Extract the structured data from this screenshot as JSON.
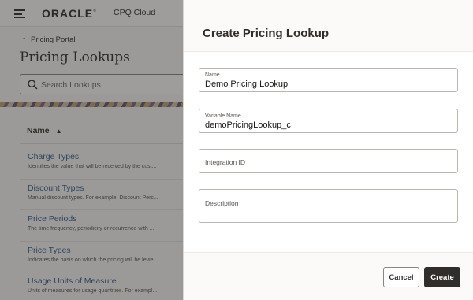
{
  "header": {
    "brand": "ORACLE",
    "brand_mark": "®",
    "app_name": "CPQ Cloud"
  },
  "breadcrumb": {
    "label": "Pricing Portal"
  },
  "page": {
    "title": "Pricing Lookups"
  },
  "search": {
    "placeholder": "Search Lookups"
  },
  "table": {
    "column_header": "Name",
    "items": [
      {
        "name": "Charge Types",
        "description": "Identifies the value that will be received by the cust..."
      },
      {
        "name": "Discount Types",
        "description": "Manual discount types. For example, Discount Perc..."
      },
      {
        "name": "Price Periods",
        "description": "The time frequency, periodicity or recurrence with ..."
      },
      {
        "name": "Price Types",
        "description": "Indicates the basis on which the pricing will be levie..."
      },
      {
        "name": "Usage Units of Measure",
        "description": "Units of measures for usage quantities. For exampl..."
      }
    ]
  },
  "drawer": {
    "title": "Create Pricing Lookup",
    "fields": {
      "name": {
        "label": "Name",
        "value": "Demo Pricing Lookup"
      },
      "variable_name": {
        "label": "Variable Name",
        "value": "demoPricingLookup_c"
      },
      "integration_id": {
        "label": "Integration ID",
        "value": ""
      },
      "description": {
        "label": "Description",
        "value": ""
      }
    },
    "buttons": {
      "cancel": "Cancel",
      "create": "Create"
    }
  },
  "colors": {
    "link": "#2f5f8c",
    "primary_button": "#312d2a",
    "overlay": "rgba(40,38,36,0.45)"
  },
  "icons": {
    "menu": "hamburger-icon",
    "breadcrumb": "arrow-up-icon",
    "search": "search-icon",
    "sort": "sort-ascending-icon"
  }
}
